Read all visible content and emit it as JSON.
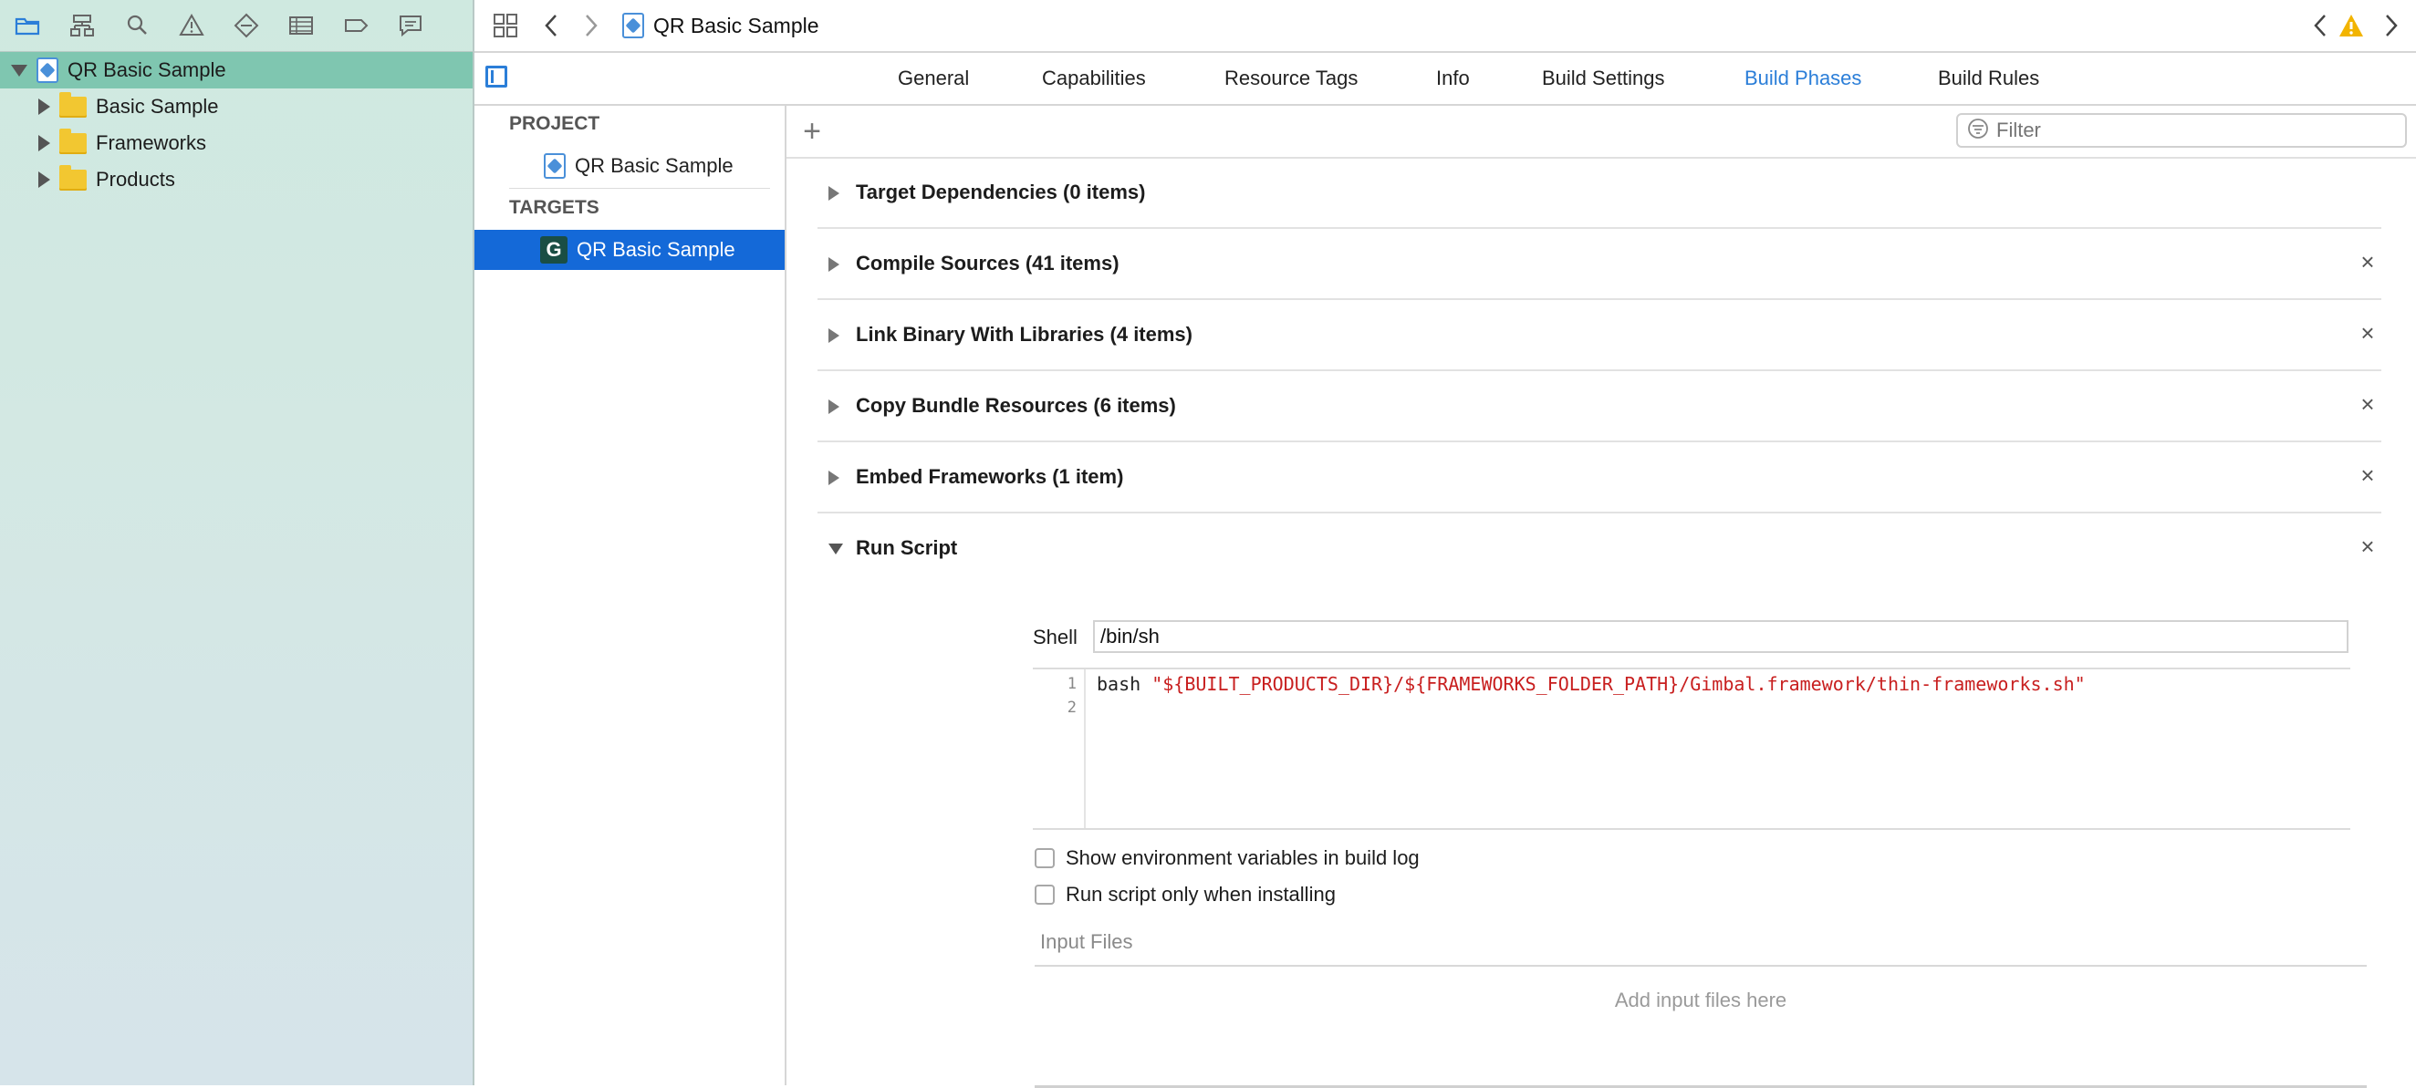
{
  "navigator": {
    "toolbar_icons": [
      "folder-icon",
      "hierarchy-icon",
      "search-icon",
      "warning-icon",
      "test-icon",
      "list-icon",
      "breakpoint-icon",
      "comment-icon"
    ],
    "root": {
      "label": "QR Basic Sample"
    },
    "children": [
      {
        "label": "Basic Sample"
      },
      {
        "label": "Frameworks"
      },
      {
        "label": "Products"
      }
    ]
  },
  "topbar": {
    "title": "QR Basic Sample"
  },
  "tabs": {
    "items": [
      "General",
      "Capabilities",
      "Resource Tags",
      "Info",
      "Build Settings",
      "Build Phases",
      "Build Rules"
    ],
    "active": "Build Phases"
  },
  "targets": {
    "project_heading": "PROJECT",
    "project_item": "QR Basic Sample",
    "targets_heading": "TARGETS",
    "target_item": "QR Basic Sample",
    "target_icon_letter": "G"
  },
  "editor": {
    "filter_placeholder": "Filter",
    "phases": [
      {
        "title": "Target Dependencies (0 items)",
        "closable": false
      },
      {
        "title": "Compile Sources (41 items)",
        "closable": true
      },
      {
        "title": "Link Binary With Libraries (4 items)",
        "closable": true
      },
      {
        "title": "Copy Bundle Resources (6 items)",
        "closable": true
      },
      {
        "title": "Embed Frameworks (1 item)",
        "closable": true
      },
      {
        "title": "Run Script",
        "closable": true
      }
    ],
    "close_glyph": "×",
    "run_script": {
      "shell_label": "Shell",
      "shell_value": "/bin/sh",
      "line_numbers": [
        "1",
        "2"
      ],
      "code_cmd": "bash ",
      "code_string": "\"${BUILT_PRODUCTS_DIR}/${FRAMEWORKS_FOLDER_PATH}/Gimbal.framework/thin-frameworks.sh\"",
      "option_env": "Show environment variables in build log",
      "option_install": "Run script only when installing",
      "input_files_heading": "Input Files",
      "input_files_empty": "Add input files here"
    }
  },
  "colors": {
    "accent": "#2b7ed8",
    "selection": "#1469d8",
    "sidebar_selected": "#7fc6b0",
    "code_string": "#c81f1f",
    "warning": "#f2b400"
  }
}
